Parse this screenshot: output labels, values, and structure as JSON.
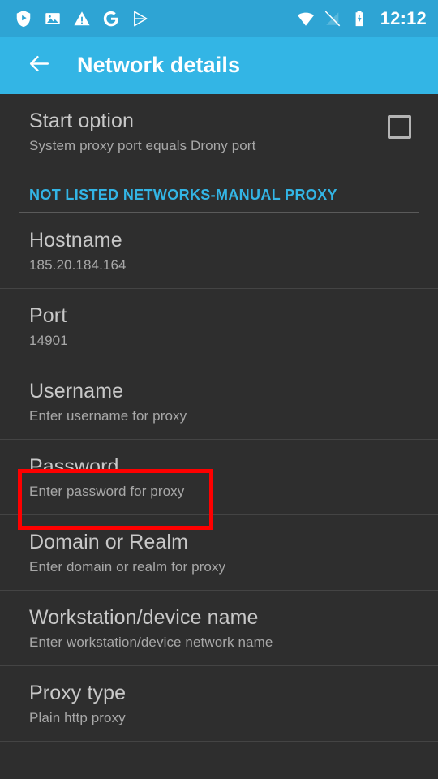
{
  "status_bar": {
    "background_color": "#2ea4d4",
    "time": "12:12",
    "left_icons": [
      {
        "name": "shield-play-icon",
        "label": "shield-play"
      },
      {
        "name": "photo-image-icon",
        "label": "photo"
      },
      {
        "name": "warning-triangle-icon",
        "label": "warning"
      },
      {
        "name": "google-g-icon",
        "label": "Google"
      },
      {
        "name": "play-store-icon",
        "label": "Play Store"
      }
    ],
    "right_icons": [
      {
        "name": "wifi-icon",
        "label": "wifi"
      },
      {
        "name": "no-sim-signal-icon",
        "label": "no signal"
      },
      {
        "name": "battery-charging-icon",
        "label": "battery charging"
      }
    ]
  },
  "app_bar": {
    "background_color": "#33b5e5",
    "back_label": "Back",
    "title": "Network details"
  },
  "prefs": {
    "start_option": {
      "title": "Start option",
      "summary": "System proxy port equals Drony port",
      "checkbox_checked": false
    },
    "section_header": "NOT LISTED NETWORKS-MANUAL PROXY",
    "section_header_color": "#33b5e5",
    "items": [
      {
        "name": "hostname",
        "title": "Hostname",
        "summary": "185.20.184.164"
      },
      {
        "name": "port",
        "title": "Port",
        "summary": "14901"
      },
      {
        "name": "username",
        "title": "Username",
        "summary": "Enter username for proxy",
        "highlighted": true
      },
      {
        "name": "password",
        "title": "Password",
        "summary": "Enter password for proxy"
      },
      {
        "name": "domain-or-realm",
        "title": "Domain or Realm",
        "summary": "Enter domain or realm for proxy"
      },
      {
        "name": "workstation-device-name",
        "title": "Workstation/device name",
        "summary": "Enter workstation/device network name"
      },
      {
        "name": "proxy-type",
        "title": "Proxy type",
        "summary": "Plain http proxy"
      }
    ]
  },
  "annotation": {
    "highlight_color": "#fe0000",
    "target": "username"
  }
}
